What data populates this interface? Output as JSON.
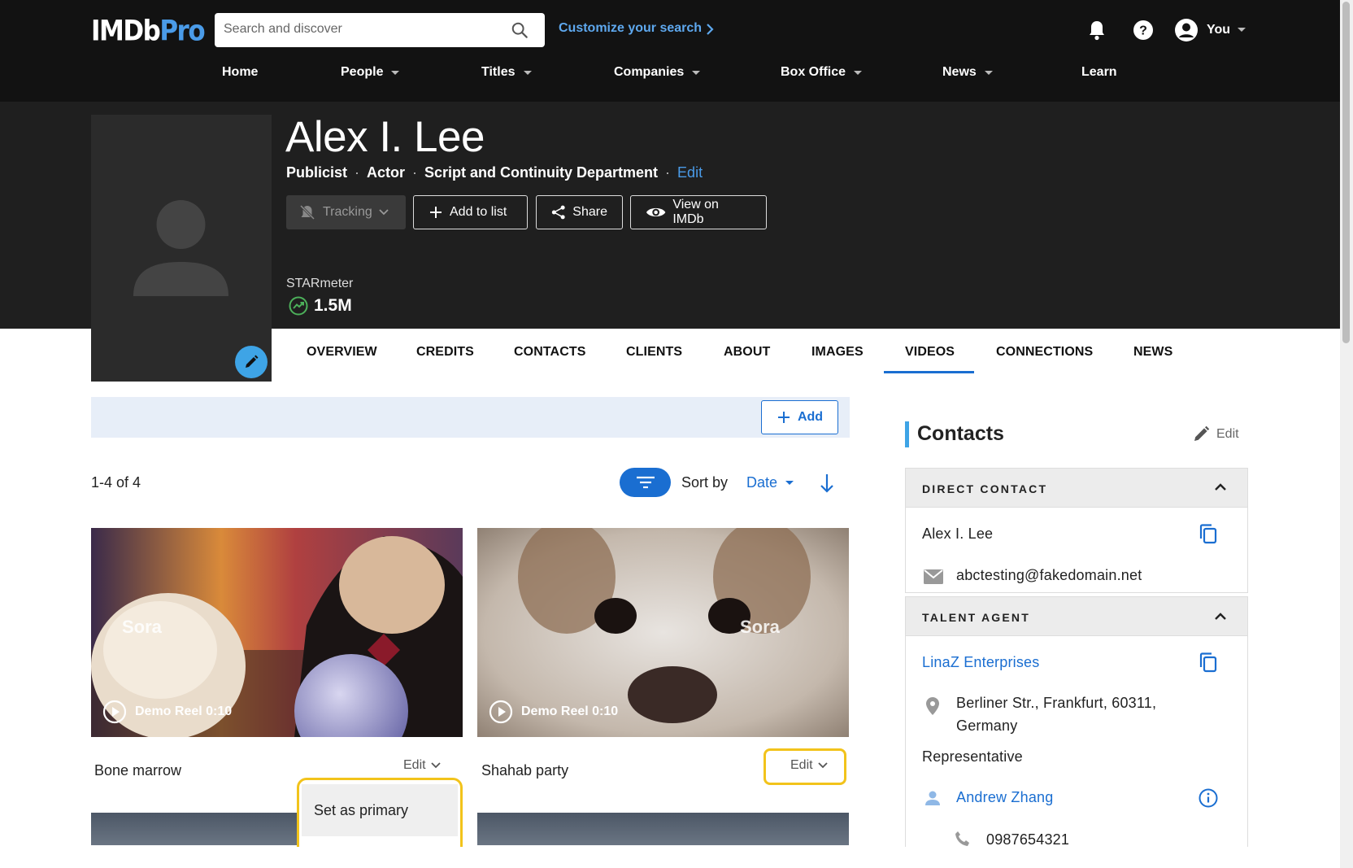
{
  "header": {
    "logo_main": "IMDb",
    "logo_pro": "Pro",
    "search_placeholder": "Search and discover",
    "customize_label": "Customize your search",
    "user_label": "You",
    "nav": [
      "Home",
      "People",
      "Titles",
      "Companies",
      "Box Office",
      "News",
      "Learn"
    ]
  },
  "profile": {
    "name": "Alex I. Lee",
    "roles": [
      "Publicist",
      "Actor",
      "Script and Continuity Department"
    ],
    "roles_edit": "Edit",
    "buttons": {
      "tracking": "Tracking",
      "add_to_list": "Add to list",
      "share": "Share",
      "view_on_imdb": "View on IMDb"
    },
    "starmeter_label": "STARmeter",
    "starmeter_value": "1.5M"
  },
  "tabs": [
    "OVERVIEW",
    "CREDITS",
    "CONTACTS",
    "CLIENTS",
    "ABOUT",
    "IMAGES",
    "VIDEOS",
    "CONNECTIONS",
    "NEWS"
  ],
  "active_tab": "VIDEOS",
  "videos": {
    "add_label": "Add",
    "count": "1-4 of 4",
    "sort_by_label": "Sort by",
    "sort_value": "Date",
    "items": [
      {
        "thumb_label": "Demo Reel 0:10",
        "title": "Bone marrow",
        "edit_label": "Edit",
        "overlay_brand": "Sora"
      },
      {
        "thumb_label": "Demo Reel 0:10",
        "title": "Shahab party",
        "edit_label": "Edit",
        "overlay_brand": "Sora"
      }
    ],
    "menu_item": "Set as primary"
  },
  "contacts": {
    "title": "Contacts",
    "edit_label": "Edit",
    "direct_contact": {
      "heading": "DIRECT CONTACT",
      "name": "Alex I. Lee",
      "email": "abctesting@fakedomain.net"
    },
    "talent_agent": {
      "heading": "TALENT AGENT",
      "company": "LinaZ Enterprises",
      "address_line1": "Berliner Str., Frankfurt, 60311,",
      "address_line2": "Germany",
      "representative_label": "Representative",
      "rep_name": "Andrew Zhang",
      "phone": "0987654321"
    }
  },
  "colors": {
    "accent_blue": "#1a6ed1",
    "highlight_yellow": "#f2c31b",
    "header_bg": "#121212",
    "hero_bg": "#1f1f1f"
  }
}
